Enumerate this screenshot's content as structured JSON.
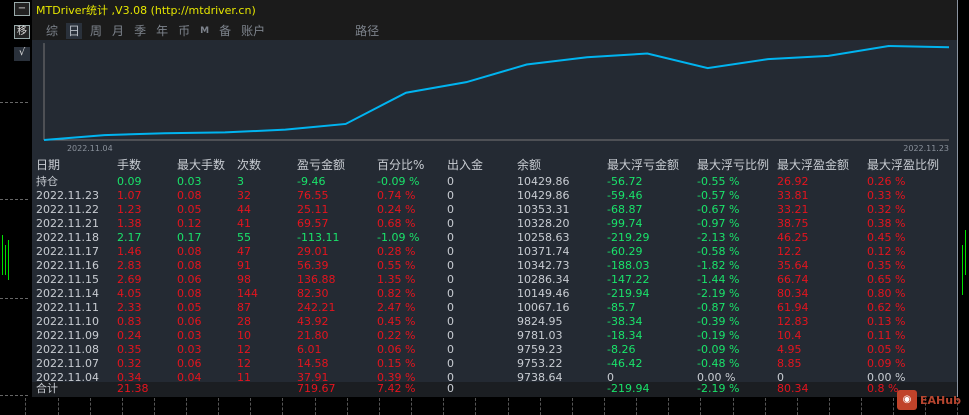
{
  "window": {
    "title": "MTDriver统计 ,V3.08 (http://mtdriver.cn)"
  },
  "side_buttons": [
    "−",
    "移",
    "√"
  ],
  "tabs": [
    {
      "label": "综"
    },
    {
      "label": "日",
      "active": true
    },
    {
      "label": "周"
    },
    {
      "label": "月"
    },
    {
      "label": "季"
    },
    {
      "label": "年"
    },
    {
      "label": "币"
    },
    {
      "label": "M"
    },
    {
      "label": "备"
    },
    {
      "label": "账户"
    },
    {
      "label": "路径"
    }
  ],
  "chart_data": {
    "type": "line",
    "x_start_label": "2022.11.04",
    "x_end_label": "2022.11.23",
    "series": [
      {
        "name": "余额",
        "values": [
          9700.73,
          9738.64,
          9753.22,
          9759.23,
          9781.03,
          9824.95,
          10067.16,
          10149.46,
          10286.34,
          10342.73,
          10371.74,
          10258.63,
          10328.2,
          10353.31,
          10429.86,
          10420.4
        ]
      }
    ],
    "color": "#00b4f0"
  },
  "table": {
    "headers": [
      "日期",
      "手数",
      "最大手数",
      "次数",
      "盈亏金额",
      "百分比%",
      "出入金",
      "余额",
      "最大浮亏金额",
      "最大浮亏比例",
      "最大浮盈金额",
      "最大浮盈比例"
    ],
    "rows": [
      [
        "持仓",
        "0.09",
        "0.03",
        "3",
        "-9.46",
        "-0.09 %",
        "0",
        "10429.86",
        "-56.72",
        "-0.55 %",
        "26.92",
        "0.26 %"
      ],
      [
        "2022.11.23",
        "1.07",
        "0.08",
        "32",
        "76.55",
        "0.74 %",
        "0",
        "10429.86",
        "-59.46",
        "-0.57 %",
        "33.81",
        "0.33 %"
      ],
      [
        "2022.11.22",
        "1.23",
        "0.05",
        "44",
        "25.11",
        "0.24 %",
        "0",
        "10353.31",
        "-68.87",
        "-0.67 %",
        "33.21",
        "0.32 %"
      ],
      [
        "2022.11.21",
        "1.38",
        "0.12",
        "41",
        "69.57",
        "0.68 %",
        "0",
        "10328.20",
        "-99.74",
        "-0.97 %",
        "38.75",
        "0.38 %"
      ],
      [
        "2022.11.18",
        "2.17",
        "0.17",
        "55",
        "-113.11",
        "-1.09 %",
        "0",
        "10258.63",
        "-219.29",
        "-2.13 %",
        "46.25",
        "0.45 %"
      ],
      [
        "2022.11.17",
        "1.46",
        "0.08",
        "47",
        "29.01",
        "0.28 %",
        "0",
        "10371.74",
        "-60.29",
        "-0.58 %",
        "12.2",
        "0.12 %"
      ],
      [
        "2022.11.16",
        "2.83",
        "0.08",
        "91",
        "56.39",
        "0.55 %",
        "0",
        "10342.73",
        "-188.03",
        "-1.82 %",
        "35.64",
        "0.35 %"
      ],
      [
        "2022.11.15",
        "2.69",
        "0.06",
        "98",
        "136.88",
        "1.35 %",
        "0",
        "10286.34",
        "-147.22",
        "-1.44 %",
        "66.74",
        "0.65 %"
      ],
      [
        "2022.11.14",
        "4.05",
        "0.08",
        "144",
        "82.30",
        "0.82 %",
        "0",
        "10149.46",
        "-219.94",
        "-2.19 %",
        "80.34",
        "0.80 %"
      ],
      [
        "2022.11.11",
        "2.33",
        "0.05",
        "87",
        "242.21",
        "2.47 %",
        "0",
        "10067.16",
        "-85.7",
        "-0.87 %",
        "61.94",
        "0.62 %"
      ],
      [
        "2022.11.10",
        "0.83",
        "0.06",
        "28",
        "43.92",
        "0.45 %",
        "0",
        "9824.95",
        "-38.34",
        "-0.39 %",
        "12.83",
        "0.13 %"
      ],
      [
        "2022.11.09",
        "0.24",
        "0.03",
        "10",
        "21.80",
        "0.22 %",
        "0",
        "9781.03",
        "-18.34",
        "-0.19 %",
        "10.4",
        "0.11 %"
      ],
      [
        "2022.11.08",
        "0.35",
        "0.03",
        "12",
        "6.01",
        "0.06 %",
        "0",
        "9759.23",
        "-8.26",
        "-0.09 %",
        "4.95",
        "0.05 %"
      ],
      [
        "2022.11.07",
        "0.32",
        "0.06",
        "12",
        "14.58",
        "0.15 %",
        "0",
        "9753.22",
        "-46.42",
        "-0.48 %",
        "8.85",
        "0.09 %"
      ],
      [
        "2022.11.04",
        "0.34",
        "0.04",
        "11",
        "37.91",
        "0.39 %",
        "0",
        "9738.64",
        "0",
        "0.00 %",
        "0",
        "0.00 %"
      ]
    ],
    "total": [
      "合计",
      "21.38",
      "",
      "",
      "719.67",
      "7.42 %",
      "0",
      "",
      "-219.94",
      "-2.19 %",
      "80.34",
      "0.8 %"
    ]
  },
  "colors": {
    "profit": "#e4141e",
    "loss": "#19e36a",
    "neutral": "#c8ccd2"
  },
  "watermark": "EAHub"
}
